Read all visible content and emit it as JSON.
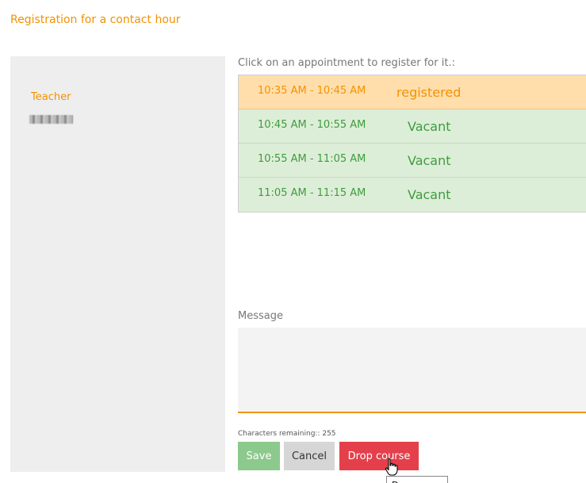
{
  "page": {
    "title": "Registration for a contact hour"
  },
  "sidebar": {
    "teacher_label": "Teacher"
  },
  "slots": {
    "instructions": "Click on an appointment to register for it.:",
    "items": [
      {
        "time": "10:35 AM - 10:45 AM",
        "status": "registered"
      },
      {
        "time": "10:45 AM - 10:55 AM",
        "status": "Vacant"
      },
      {
        "time": "10:55 AM - 11:05 AM",
        "status": "Vacant"
      },
      {
        "time": "11:05 AM - 11:15 AM",
        "status": "Vacant"
      }
    ]
  },
  "message": {
    "label": "Message",
    "value": "",
    "chars_remaining": "Characters remaining:: 255"
  },
  "buttons": {
    "save": "Save",
    "cancel": "Cancel",
    "drop": "Drop course"
  },
  "tooltip": {
    "text": "Drop course"
  },
  "colors": {
    "accent": "#f39200",
    "registered_bg": "#ffdeac",
    "vacant_bg": "#ddeed8",
    "vacant_text": "#3e9c3e",
    "save_bg": "#8cc98c",
    "cancel_bg": "#d6d6d6",
    "drop_bg": "#e4404b"
  }
}
